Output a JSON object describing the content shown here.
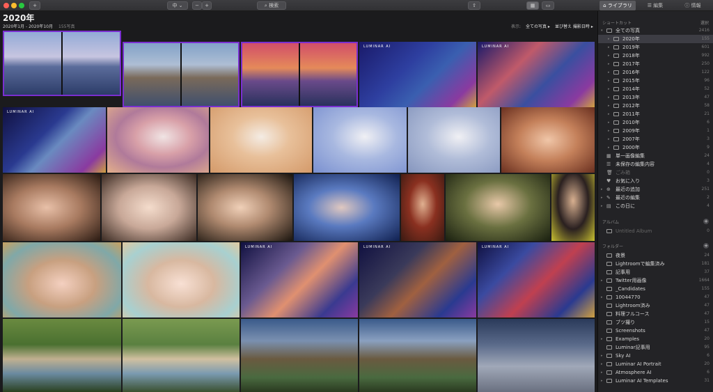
{
  "toolbar": {
    "add": "+",
    "zoom": "中",
    "minus": "−",
    "plus": "+",
    "search": "検索",
    "tabs": [
      "ライブラリ",
      "編集",
      "情報"
    ]
  },
  "main": {
    "title": "2020年",
    "date_range": "2020年1月 - 2020年10月",
    "count": "155写真",
    "filter_label": "表示:",
    "filter_value": "全ての写真 ▸",
    "sort_value": "並び替え 撮影日時 ▸",
    "logo_tag": "LUMINAR AI"
  },
  "sidebar": {
    "shortcuts_header": "ショートカット",
    "select": "選択",
    "shortcuts": [
      {
        "label": "全ての写真",
        "count": "2416",
        "level": 0,
        "chev": "▾"
      },
      {
        "label": "2020年",
        "count": "155",
        "level": 1,
        "chev": "▸",
        "active": true
      },
      {
        "label": "2019年",
        "count": "601",
        "level": 1,
        "chev": "▸"
      },
      {
        "label": "2018年",
        "count": "992",
        "level": 1,
        "chev": "▸"
      },
      {
        "label": "2017年",
        "count": "250",
        "level": 1,
        "chev": "▸"
      },
      {
        "label": "2016年",
        "count": "122",
        "level": 1,
        "chev": "▸"
      },
      {
        "label": "2015年",
        "count": "96",
        "level": 1,
        "chev": "▸"
      },
      {
        "label": "2014年",
        "count": "52",
        "level": 1,
        "chev": "▸"
      },
      {
        "label": "2013年",
        "count": "47",
        "level": 1,
        "chev": "▸"
      },
      {
        "label": "2012年",
        "count": "58",
        "level": 1,
        "chev": "▸"
      },
      {
        "label": "2011年",
        "count": "21",
        "level": 1,
        "chev": "▸"
      },
      {
        "label": "2010年",
        "count": "6",
        "level": 1,
        "chev": "▸"
      },
      {
        "label": "2009年",
        "count": "1",
        "level": 1,
        "chev": "▸"
      },
      {
        "label": "2007年",
        "count": "3",
        "level": 1,
        "chev": "▸"
      },
      {
        "label": "2000年",
        "count": "9",
        "level": 1,
        "chev": "▸"
      },
      {
        "label": "単一画像編集",
        "count": "24",
        "level": 0,
        "glyph": "▦"
      },
      {
        "label": "未保存の編集内容",
        "count": "4",
        "level": 0,
        "glyph": "☰"
      },
      {
        "label": "ごみ箱",
        "count": "0",
        "level": 0,
        "glyph": "🗑",
        "dim": true
      },
      {
        "label": "お気に入り",
        "count": "3",
        "level": 0,
        "glyph": "♥"
      },
      {
        "label": "最近の追加",
        "count": "251",
        "level": 0,
        "glyph": "⊕",
        "chev": "▸"
      },
      {
        "label": "最近の編集",
        "count": "2",
        "level": 0,
        "glyph": "✎",
        "chev": "▸"
      },
      {
        "label": "この日に",
        "count": "4",
        "level": 0,
        "glyph": "▤",
        "chev": "▸"
      }
    ],
    "album_header": "アルバム",
    "album_plus": "+",
    "albums": [
      {
        "label": "Untitled Album",
        "count": "0",
        "dim": true
      }
    ],
    "folder_header": "フォルダー",
    "folder_plus": "+",
    "folders": [
      {
        "label": "夜景",
        "count": "24"
      },
      {
        "label": "Lightroomで編集済み",
        "count": "181"
      },
      {
        "label": "記事用",
        "count": "37"
      },
      {
        "label": "Twitter用画像",
        "count": "1664",
        "chev": "▸"
      },
      {
        "label": "_Candidates",
        "count": "155"
      },
      {
        "label": "10044770",
        "count": "47",
        "chev": "▸"
      },
      {
        "label": "Lightroom済み",
        "count": "47"
      },
      {
        "label": "料理フルコース",
        "count": "47"
      },
      {
        "label": "ブツ撮り",
        "count": "15"
      },
      {
        "label": "Screenshots",
        "count": "47"
      },
      {
        "label": "Examples",
        "count": "20",
        "chev": "▸"
      },
      {
        "label": "Luminar記事用",
        "count": "95"
      },
      {
        "label": "Sky AI",
        "count": "6",
        "chev": "▸"
      },
      {
        "label": "Luminar AI Portrait",
        "count": "20",
        "chev": "▸"
      },
      {
        "label": "Atmosphere AI",
        "count": "6",
        "chev": "▸"
      },
      {
        "label": "Luminar AI Templates",
        "count": "31",
        "chev": "▸"
      }
    ]
  },
  "colors": {
    "accent": "#7a2fd0",
    "sidebar_bg": "#232326",
    "main_bg": "#1b1b1d",
    "selected_row": "#3d3d44"
  }
}
